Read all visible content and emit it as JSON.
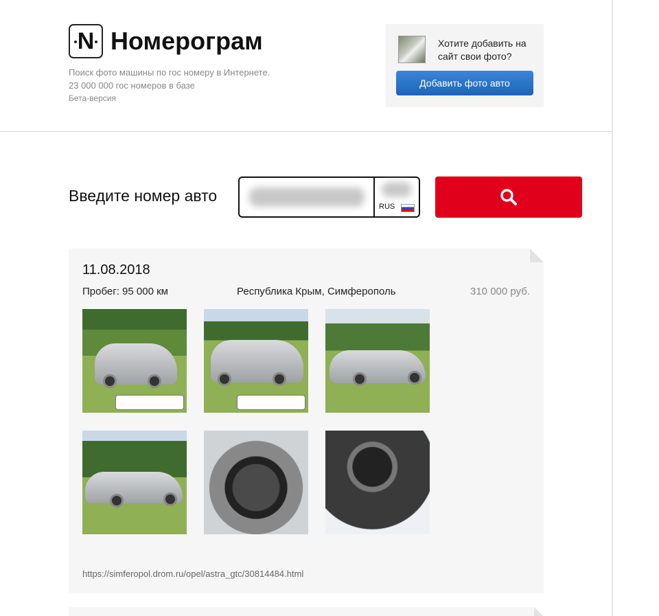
{
  "header": {
    "logo_letter": "N",
    "title": "Номерограм",
    "tagline_line1": "Поиск фото машины по гос номеру в Интернете.",
    "tagline_line2": "23 000 000 гос номеров в базе",
    "beta": "Бета-версия"
  },
  "promo": {
    "text": "Хотите добавить на сайт свои фото?",
    "button_label": "Добавить фото авто",
    "button_color": "#1f6bbf"
  },
  "search": {
    "label": "Введите номер авто",
    "plate_country": "RUS",
    "button_color": "#e0001b",
    "button_icon": "search-icon"
  },
  "listing": {
    "date": "11.08.2018",
    "mileage": "Пробег: 95 000 км",
    "location": "Республика Крым, Симферополь",
    "price": "310 000 руб.",
    "photos": [
      "car-front-left",
      "car-rear-left",
      "car-side-left",
      "car-side-left-2",
      "steering-wheel",
      "dashboard-interior"
    ],
    "url": "https://simferopol.drom.ru/opel/astra_gtc/30814484.html"
  }
}
